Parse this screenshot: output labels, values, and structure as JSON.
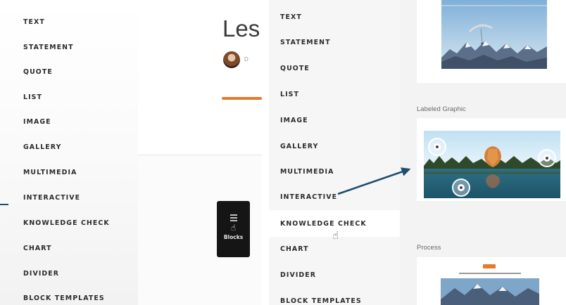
{
  "left_panel": {
    "sidebar": {
      "items": [
        {
          "label": "TEXT"
        },
        {
          "label": "STATEMENT"
        },
        {
          "label": "QUOTE"
        },
        {
          "label": "LIST"
        },
        {
          "label": "IMAGE"
        },
        {
          "label": "GALLERY"
        },
        {
          "label": "MULTIMEDIA"
        },
        {
          "label": "INTERACTIVE"
        },
        {
          "label": "KNOWLEDGE CHECK"
        },
        {
          "label": "CHART"
        },
        {
          "label": "DIVIDER"
        },
        {
          "label": "BLOCK TEMPLATES"
        }
      ]
    },
    "content": {
      "title": "Les",
      "author_initial": "D",
      "blocks_button_label": "Blocks",
      "blocks_icon": "grid-icon",
      "cursor_icon": "hand-pointer-icon"
    }
  },
  "right_panel": {
    "sidebar": {
      "items": [
        {
          "label": "TEXT"
        },
        {
          "label": "STATEMENT"
        },
        {
          "label": "QUOTE"
        },
        {
          "label": "LIST"
        },
        {
          "label": "IMAGE"
        },
        {
          "label": "GALLERY"
        },
        {
          "label": "MULTIMEDIA"
        },
        {
          "label": "INTERACTIVE"
        },
        {
          "label": "KNOWLEDGE CHECK"
        },
        {
          "label": "CHART"
        },
        {
          "label": "DIVIDER"
        },
        {
          "label": "BLOCK TEMPLATES"
        }
      ]
    },
    "gallery": {
      "labeled_graphic_label": "Labeled Graphic",
      "process_label": "Process"
    }
  },
  "colors": {
    "accent_orange": "#e8782c",
    "arrow_blue": "#1f4e6e",
    "menu_text": "#2c2c2c"
  }
}
